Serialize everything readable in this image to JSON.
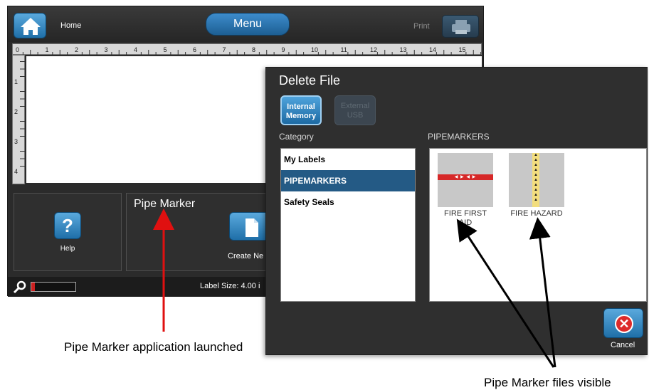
{
  "app": {
    "home_label": "Home",
    "menu_label": "Menu",
    "print_label": "Print",
    "ruler_numbers": [
      "0",
      "1",
      "2",
      "3",
      "4",
      "5",
      "6",
      "7",
      "8",
      "9",
      "10",
      "11",
      "12",
      "13",
      "14",
      "15"
    ],
    "ruler_v_numbers": [
      "1",
      "2",
      "3",
      "4"
    ],
    "help_label": "Help",
    "app_title": "Pipe Marker",
    "create_label": "Create Ne",
    "label_size": "Label Size: 4.00 i",
    "progress_fraction": 0.08
  },
  "dialog": {
    "title": "Delete File",
    "memory_internal_line1": "Internal",
    "memory_internal_line2": "Memory",
    "memory_external_line1": "External",
    "memory_external_line2": "USB",
    "category_heading": "Category",
    "files_heading": "PIPEMARKERS",
    "categories": [
      {
        "label": "My Labels",
        "selected": false
      },
      {
        "label": "PIPEMARKERS",
        "selected": true
      },
      {
        "label": "Safety Seals",
        "selected": false
      }
    ],
    "files": [
      {
        "name": "FIRE FIRST AID",
        "thumb_text": "FIRE FIRST AID"
      },
      {
        "name": "FIRE HAZARD",
        "thumb_text": "FIRE HAZARD"
      }
    ],
    "cancel_label": "Cancel"
  },
  "annotations": {
    "left_callout": "Pipe Marker application launched",
    "right_callout": "Pipe Marker files visible"
  },
  "colors": {
    "accent_blue": "#1f6fa8",
    "selected_row": "#245a85",
    "arrow_red": "#e01010",
    "arrow_black": "#000000"
  }
}
